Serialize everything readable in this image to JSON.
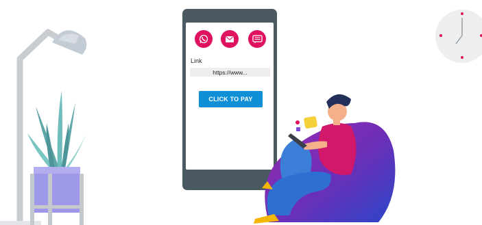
{
  "phone": {
    "share_icons": [
      "whatsapp-icon",
      "mail-icon",
      "sms-icon"
    ],
    "link_label": "Link",
    "url_value": "https://www...",
    "pay_button_label": "CLICK TO PAY"
  },
  "colors": {
    "accent_pink": "#e0115f",
    "button_blue": "#0e8fd6",
    "phone_body": "#4b5962"
  }
}
